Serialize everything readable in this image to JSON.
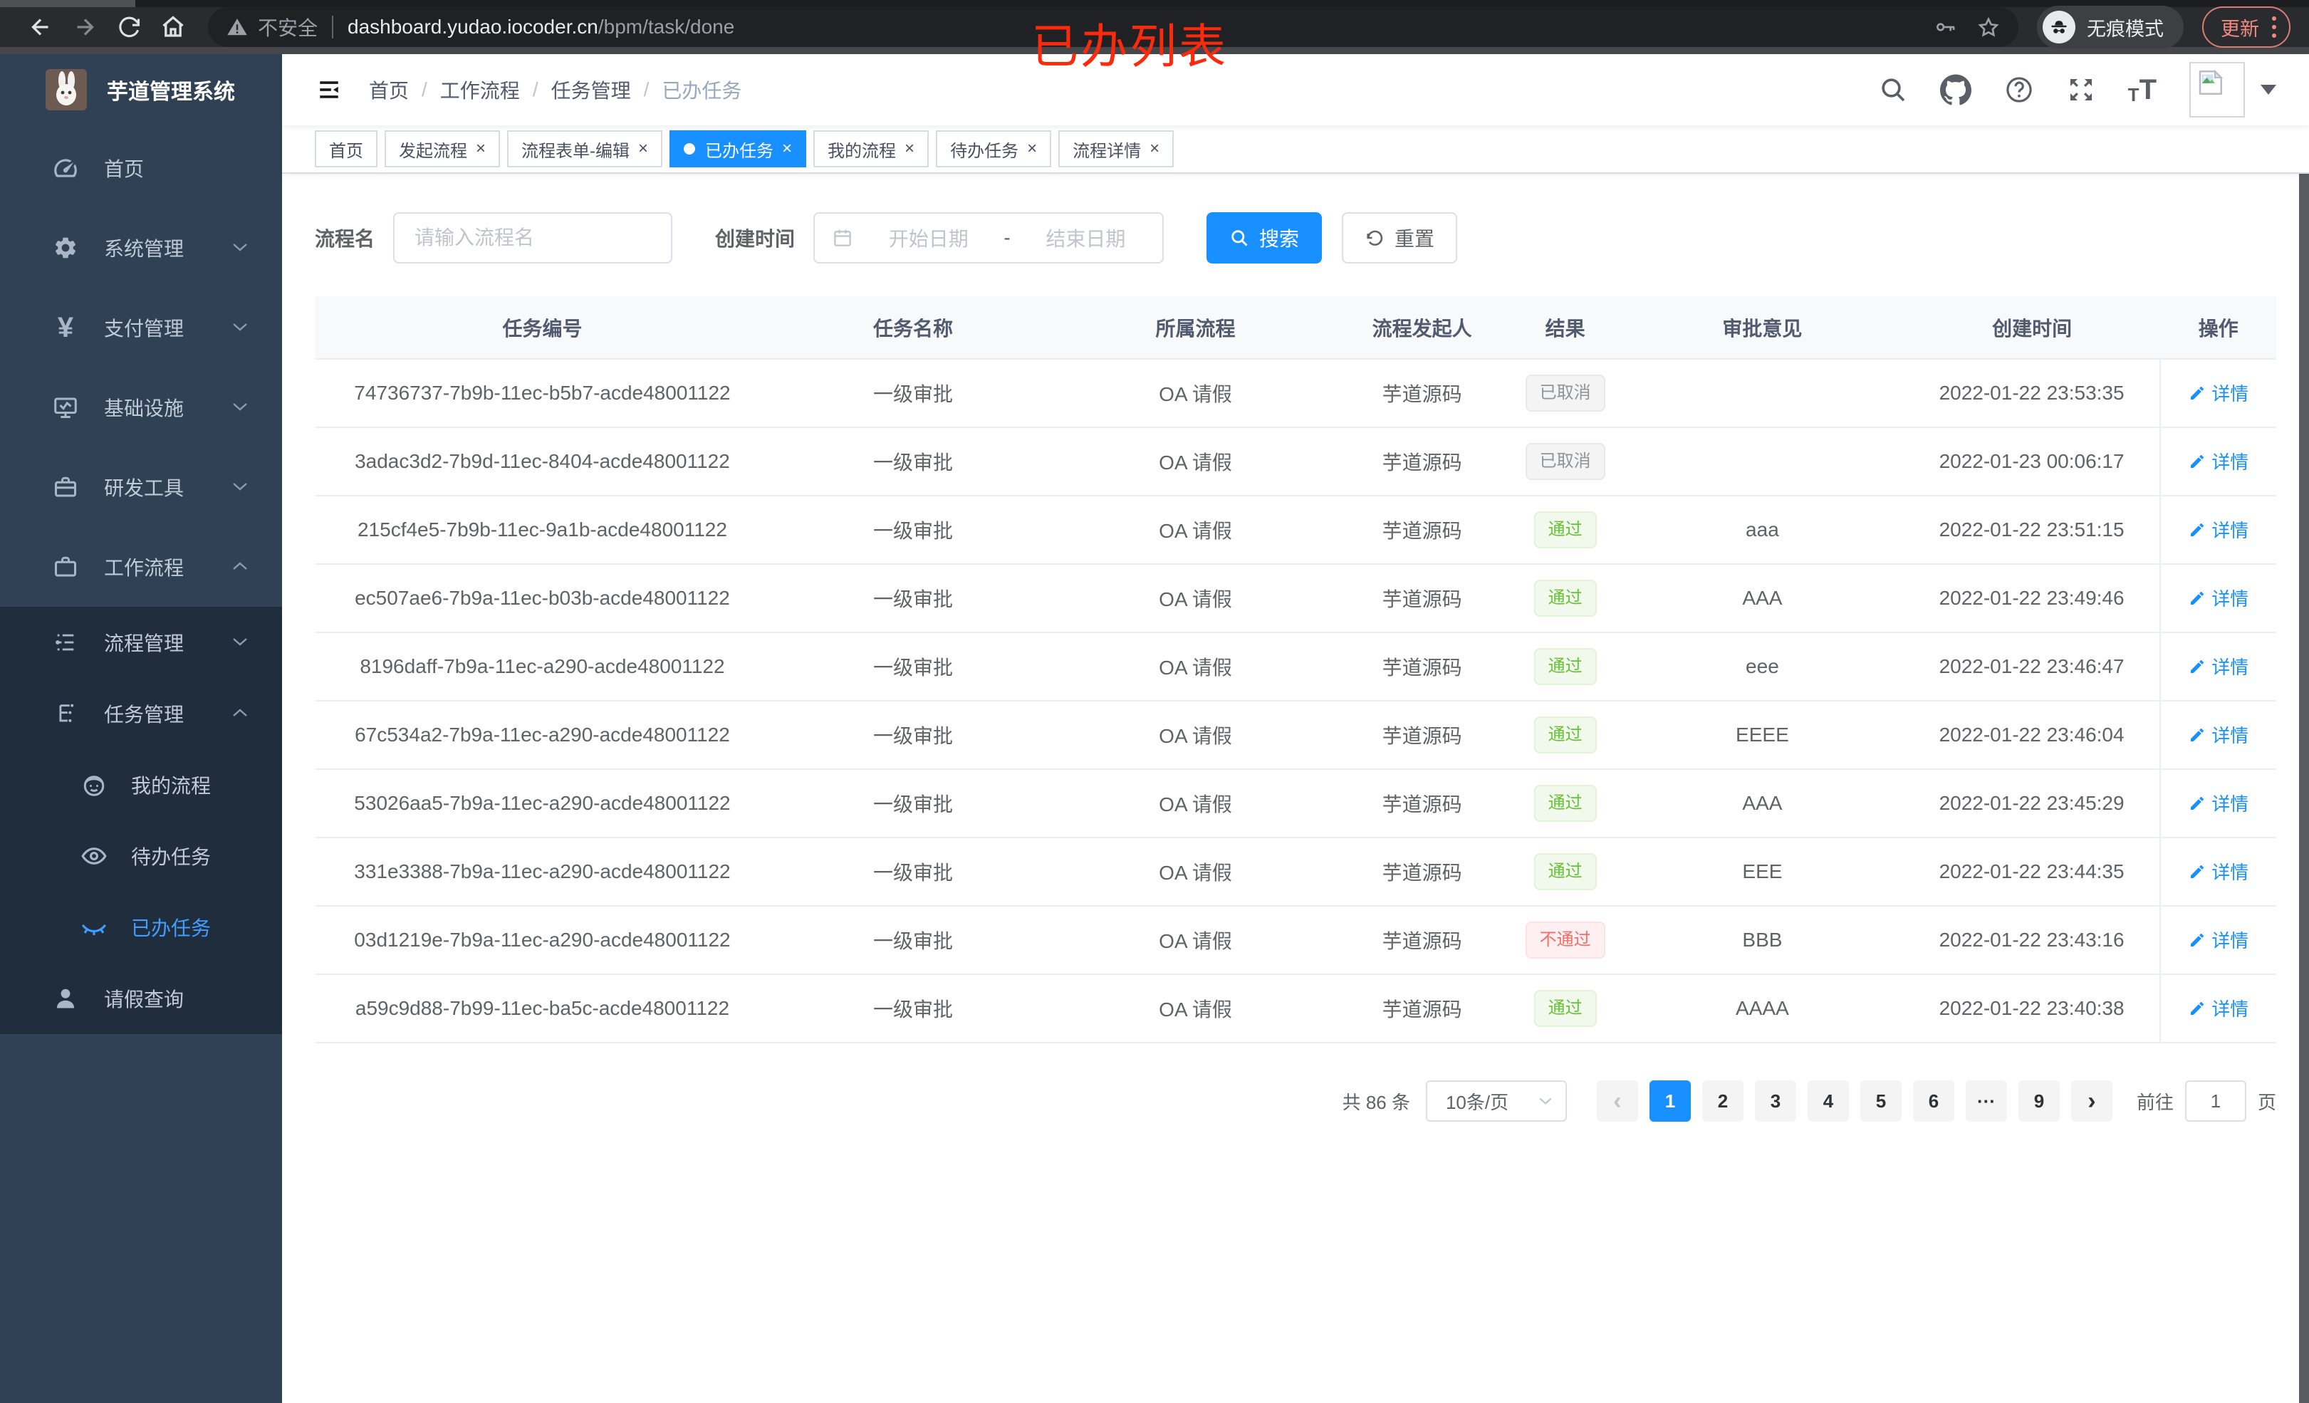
{
  "browser": {
    "security_label": "不安全",
    "url_host": "dashboard.yudao.iocoder.cn",
    "url_path": "/bpm/task/done",
    "incognito_label": "无痕模式",
    "update_label": "更新"
  },
  "annotation": "已办列表",
  "sidebar": {
    "title": "芋道管理系统",
    "items": [
      {
        "label": "首页",
        "icon": "dashboard-icon"
      },
      {
        "label": "系统管理",
        "icon": "gear-icon"
      },
      {
        "label": "支付管理",
        "icon": "yen-icon"
      },
      {
        "label": "基础设施",
        "icon": "monitor-icon"
      },
      {
        "label": "研发工具",
        "icon": "toolbox-icon"
      },
      {
        "label": "工作流程",
        "icon": "briefcase-icon",
        "children": [
          {
            "label": "流程管理",
            "icon": "flow-list-icon"
          },
          {
            "label": "任务管理",
            "icon": "task-tree-icon",
            "children": [
              {
                "label": "我的流程",
                "icon": "face-icon"
              },
              {
                "label": "待办任务",
                "icon": "eye-open-icon"
              },
              {
                "label": "已办任务",
                "icon": "eye-closed-icon",
                "active": true
              }
            ]
          },
          {
            "label": "请假查询",
            "icon": "user-icon"
          }
        ]
      }
    ]
  },
  "navbar": {
    "breadcrumb": [
      "首页",
      "工作流程",
      "任务管理",
      "已办任务"
    ]
  },
  "tabs": [
    {
      "label": "首页",
      "close": "",
      "cls": ""
    },
    {
      "label": "发起流程",
      "close": "×",
      "cls": ""
    },
    {
      "label": "流程表单-编辑",
      "close": "×",
      "cls": ""
    },
    {
      "label": "已办任务",
      "close": "×",
      "cls": "active"
    },
    {
      "label": "我的流程",
      "close": "×",
      "cls": ""
    },
    {
      "label": "待办任务",
      "close": "×",
      "cls": ""
    },
    {
      "label": "流程详情",
      "close": "×",
      "cls": ""
    }
  ],
  "filters": {
    "name_label": "流程名",
    "name_placeholder": "请输入流程名",
    "time_label": "创建时间",
    "start_placeholder": "开始日期",
    "range_separator": "-",
    "end_placeholder": "结束日期",
    "search_label": "搜索",
    "reset_label": "重置"
  },
  "table": {
    "columns": [
      "任务编号",
      "任务名称",
      "所属流程",
      "流程发起人",
      "结果",
      "审批意见",
      "创建时间",
      "操作"
    ],
    "action_label": "详情",
    "rows": [
      {
        "id": "74736737-7b9b-11ec-b5b7-acde48001122",
        "name": "一级审批",
        "process": "OA 请假",
        "starter": "芋道源码",
        "result": {
          "label": "已取消",
          "type": "info"
        },
        "comment": "",
        "created": "2022-01-22 23:53:35"
      },
      {
        "id": "3adac3d2-7b9d-11ec-8404-acde48001122",
        "name": "一级审批",
        "process": "OA 请假",
        "starter": "芋道源码",
        "result": {
          "label": "已取消",
          "type": "info"
        },
        "comment": "",
        "created": "2022-01-23 00:06:17"
      },
      {
        "id": "215cf4e5-7b9b-11ec-9a1b-acde48001122",
        "name": "一级审批",
        "process": "OA 请假",
        "starter": "芋道源码",
        "result": {
          "label": "通过",
          "type": "success"
        },
        "comment": "aaa",
        "created": "2022-01-22 23:51:15"
      },
      {
        "id": "ec507ae6-7b9a-11ec-b03b-acde48001122",
        "name": "一级审批",
        "process": "OA 请假",
        "starter": "芋道源码",
        "result": {
          "label": "通过",
          "type": "success"
        },
        "comment": "AAA",
        "created": "2022-01-22 23:49:46"
      },
      {
        "id": "8196daff-7b9a-11ec-a290-acde48001122",
        "name": "一级审批",
        "process": "OA 请假",
        "starter": "芋道源码",
        "result": {
          "label": "通过",
          "type": "success"
        },
        "comment": "eee",
        "created": "2022-01-22 23:46:47"
      },
      {
        "id": "67c534a2-7b9a-11ec-a290-acde48001122",
        "name": "一级审批",
        "process": "OA 请假",
        "starter": "芋道源码",
        "result": {
          "label": "通过",
          "type": "success"
        },
        "comment": "EEEE",
        "created": "2022-01-22 23:46:04"
      },
      {
        "id": "53026aa5-7b9a-11ec-a290-acde48001122",
        "name": "一级审批",
        "process": "OA 请假",
        "starter": "芋道源码",
        "result": {
          "label": "通过",
          "type": "success"
        },
        "comment": "AAA",
        "created": "2022-01-22 23:45:29"
      },
      {
        "id": "331e3388-7b9a-11ec-a290-acde48001122",
        "name": "一级审批",
        "process": "OA 请假",
        "starter": "芋道源码",
        "result": {
          "label": "通过",
          "type": "success"
        },
        "comment": "EEE",
        "created": "2022-01-22 23:44:35"
      },
      {
        "id": "03d1219e-7b9a-11ec-a290-acde48001122",
        "name": "一级审批",
        "process": "OA 请假",
        "starter": "芋道源码",
        "result": {
          "label": "不通过",
          "type": "danger"
        },
        "comment": "BBB",
        "created": "2022-01-22 23:43:16"
      },
      {
        "id": "a59c9d88-7b99-11ec-ba5c-acde48001122",
        "name": "一级审批",
        "process": "OA 请假",
        "starter": "芋道源码",
        "result": {
          "label": "通过",
          "type": "success"
        },
        "comment": "AAAA",
        "created": "2022-01-22 23:40:38"
      }
    ]
  },
  "pagination": {
    "total_text": "共 86 条",
    "page_size": "10条/页",
    "pages": [
      {
        "label": "1",
        "cls": "active"
      },
      {
        "label": "2",
        "cls": ""
      },
      {
        "label": "3",
        "cls": ""
      },
      {
        "label": "4",
        "cls": ""
      },
      {
        "label": "5",
        "cls": ""
      },
      {
        "label": "6",
        "cls": ""
      },
      {
        "label": "···",
        "cls": "more"
      },
      {
        "label": "9",
        "cls": ""
      }
    ],
    "goto_label": "前往",
    "goto_value": "1",
    "goto_unit": "页"
  },
  "colors": {
    "accent": "#1890ff",
    "menu_active": "#409eff",
    "success": "#67c23a",
    "danger": "#f56c6c",
    "info": "#909399",
    "annotation_red": "#fb2a0d",
    "sidebar_bg": "#304156",
    "submenu_bg": "#1f2d3d",
    "chrome_bg": "#2a2b2e"
  }
}
